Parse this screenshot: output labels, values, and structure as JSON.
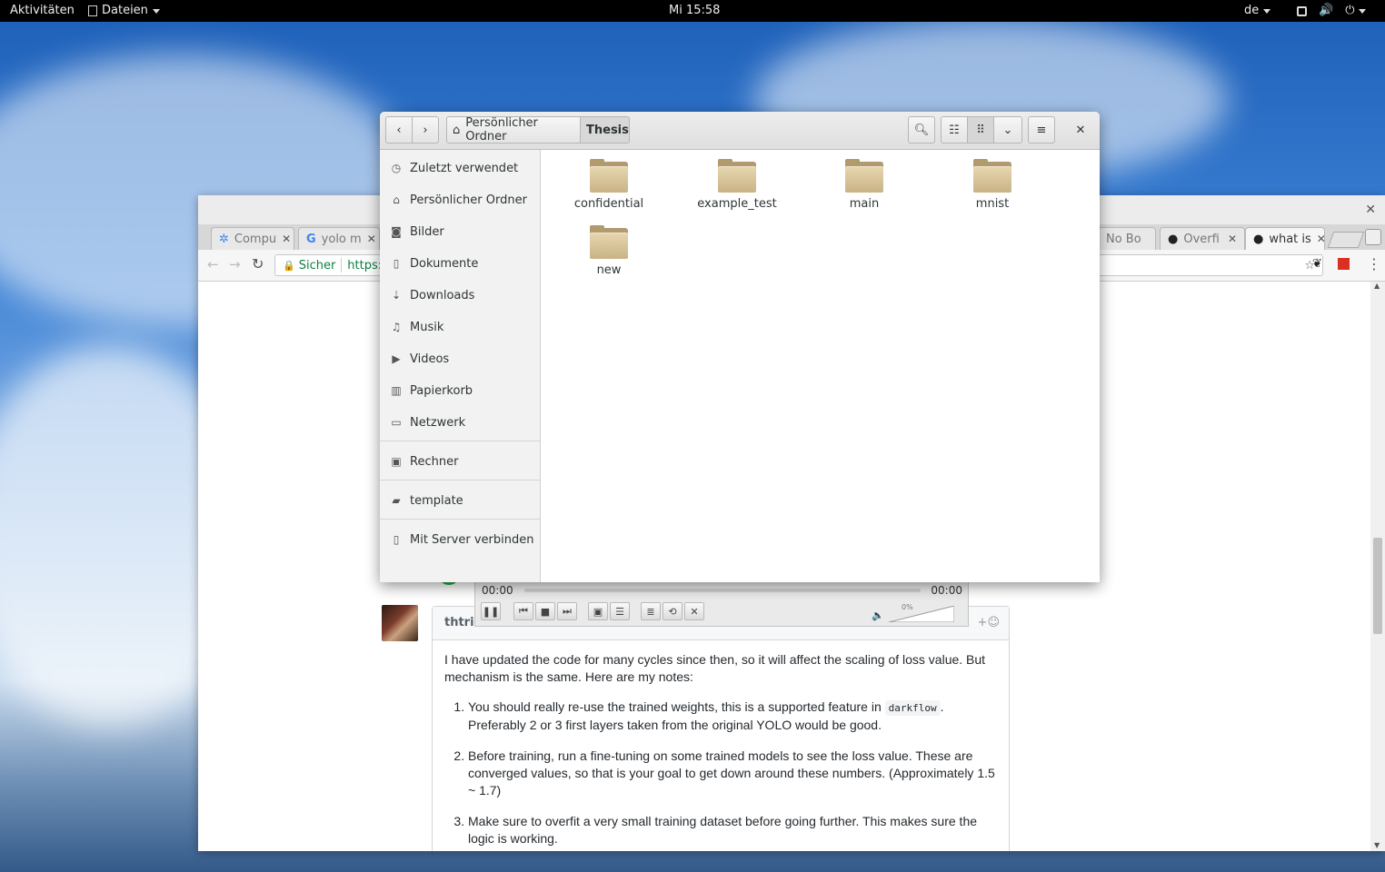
{
  "topbar": {
    "activities": "Aktivitäten",
    "app_menu": "Dateien",
    "clock": "Mi 15:58",
    "keyboard_layout": "de"
  },
  "browser": {
    "tabs": [
      {
        "label": "Compu",
        "icon": "globe-icon"
      },
      {
        "label": "yolo m",
        "icon": "google-icon"
      },
      {
        "label": "No Bo",
        "icon": "page-icon"
      },
      {
        "label": "Overfi",
        "icon": "github-icon"
      },
      {
        "label": "what is",
        "icon": "github-icon"
      }
    ],
    "secure_label": "Sicher",
    "url_prefix": "https://",
    "comment": {
      "author": "thtrieu",
      "paragraph1": "I have updated the code for many cycles since then, so it will affect the scaling of loss value. But mechanism is the same. Here are my notes:",
      "items": [
        {
          "before": "You should really re-use the trained weights, this is a supported feature in ",
          "code": "darkflow",
          "after": ". Preferably 2 or 3 first layers taken from the original YOLO would be good."
        },
        {
          "before": "Before training, run a fine-tuning on some trained models to see the loss value. These are converged values, so that is your goal to get down around these numbers. (Approximately 1.5 ~ 1.7)",
          "code": "",
          "after": ""
        },
        {
          "before": "Make sure to overfit a very small training dataset before going further. This makes sure the logic is working.",
          "code": "",
          "after": ""
        }
      ]
    }
  },
  "player": {
    "time_current": "00:00",
    "time_total": "00:00",
    "volume": "0%",
    "progress": 0
  },
  "files": {
    "breadcrumb_home": "Persönlicher Ordner",
    "breadcrumb_current": "Thesis",
    "sidebar": [
      {
        "label": "Zuletzt verwendet",
        "icon": "clock-icon"
      },
      {
        "label": "Persönlicher Ordner",
        "icon": "home-icon"
      },
      {
        "label": "Bilder",
        "icon": "camera-icon"
      },
      {
        "label": "Dokumente",
        "icon": "document-icon"
      },
      {
        "label": "Downloads",
        "icon": "download-icon"
      },
      {
        "label": "Musik",
        "icon": "music-icon"
      },
      {
        "label": "Videos",
        "icon": "video-icon"
      },
      {
        "label": "Papierkorb",
        "icon": "trash-icon"
      },
      {
        "label": "Netzwerk",
        "icon": "network-icon"
      }
    ],
    "computer": "Rechner",
    "bookmark": "template",
    "connect_server": "Mit Server verbinden",
    "folders": [
      "confidential",
      "example_test",
      "main",
      "mnist",
      "new"
    ]
  }
}
